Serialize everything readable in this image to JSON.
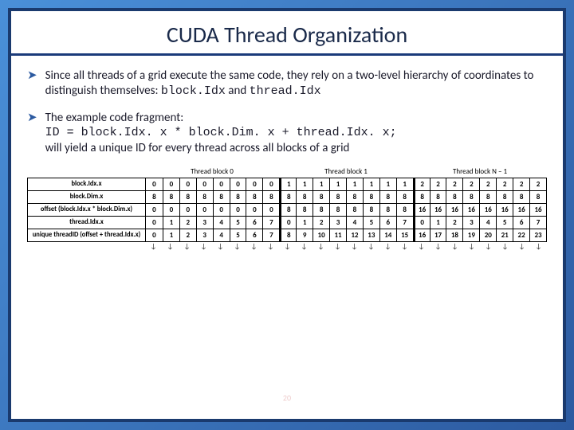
{
  "title": "CUDA Thread Organization",
  "bullets": [
    {
      "pre": "Since all threads of a grid execute the same code, they rely on a two-level hierarchy of coordinates to distinguish themselves: ",
      "code1": "block.Idx",
      "mid": " and ",
      "code2": "thread.Idx"
    },
    {
      "pre": "The example code fragment:",
      "code_line": "ID = block.Idx. x * block.Dim. x + thread.Idx. x;",
      "post": "will yield a unique ID for every thread across all blocks of a grid"
    }
  ],
  "block_labels": [
    "Thread block 0",
    "Thread block 1",
    "Thread block N – 1"
  ],
  "row_headers": [
    "block.Idx.x",
    "block.Dim.x",
    "offset\n(block.Idx.x * block.Dim.x)",
    "thread.Idx.x",
    "unique threadID\n(offset + thread.Idx.x)"
  ],
  "chart_data": {
    "type": "table",
    "rows": [
      [
        0,
        0,
        0,
        0,
        0,
        0,
        0,
        0,
        1,
        1,
        1,
        1,
        1,
        1,
        1,
        1,
        2,
        2,
        2,
        2,
        2,
        2,
        2,
        2
      ],
      [
        8,
        8,
        8,
        8,
        8,
        8,
        8,
        8,
        8,
        8,
        8,
        8,
        8,
        8,
        8,
        8,
        8,
        8,
        8,
        8,
        8,
        8,
        8,
        8
      ],
      [
        0,
        0,
        0,
        0,
        0,
        0,
        0,
        0,
        8,
        8,
        8,
        8,
        8,
        8,
        8,
        8,
        16,
        16,
        16,
        16,
        16,
        16,
        16,
        16
      ],
      [
        0,
        1,
        2,
        3,
        4,
        5,
        6,
        7,
        0,
        1,
        2,
        3,
        4,
        5,
        6,
        7,
        0,
        1,
        2,
        3,
        4,
        5,
        6,
        7
      ],
      [
        0,
        1,
        2,
        3,
        4,
        5,
        6,
        7,
        8,
        9,
        10,
        11,
        12,
        13,
        14,
        15,
        16,
        17,
        18,
        19,
        20,
        21,
        22,
        23
      ]
    ]
  },
  "page_number": "20",
  "down_arrow": "↓"
}
